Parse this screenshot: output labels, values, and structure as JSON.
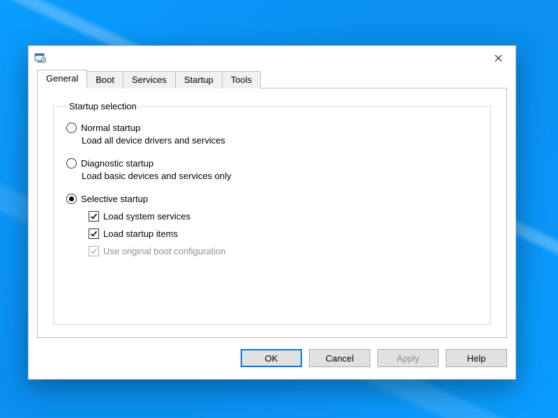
{
  "tabs": {
    "general": "General",
    "boot": "Boot",
    "services": "Services",
    "startup": "Startup",
    "tools": "Tools"
  },
  "group": {
    "legend": "Startup selection",
    "normal": {
      "label": "Normal startup",
      "desc": "Load all device drivers and services"
    },
    "diagnostic": {
      "label": "Diagnostic startup",
      "desc": "Load basic devices and services only"
    },
    "selective": {
      "label": "Selective startup",
      "load_system": "Load system services",
      "load_startup": "Load startup items",
      "use_original": "Use original boot configuration"
    }
  },
  "buttons": {
    "ok": "OK",
    "cancel": "Cancel",
    "apply": "Apply",
    "help": "Help"
  }
}
